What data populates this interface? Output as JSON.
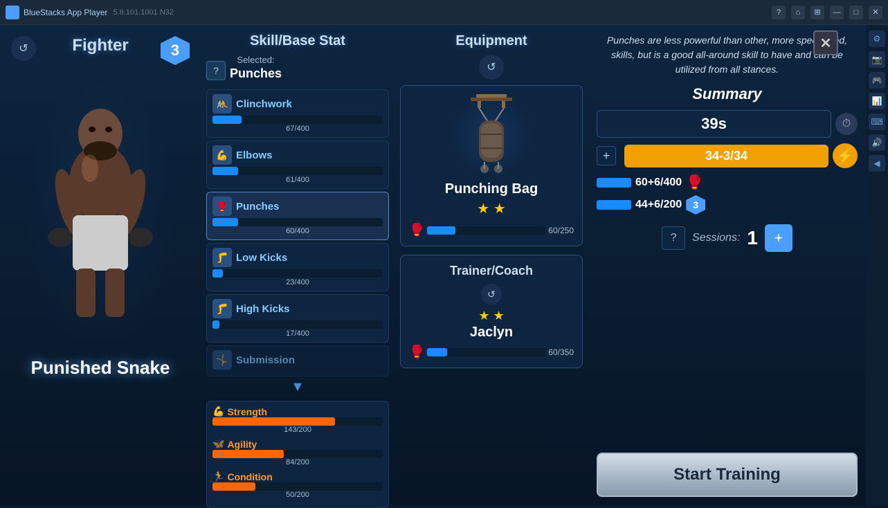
{
  "titlebar": {
    "appName": "BlueStacks App Player",
    "version": "5.8.101.1001  N32"
  },
  "fighter": {
    "title": "Fighter",
    "name": "Punished Snake",
    "level": "3",
    "refreshLabel": "↺"
  },
  "skillPanel": {
    "title": "Skill/Base Stat",
    "selectedLabel": "Selected:",
    "selectedSkill": "Punches",
    "helpLabel": "?",
    "skills": [
      {
        "name": "Clinchwork",
        "value": "67/400",
        "pct": 17,
        "color": "blue"
      },
      {
        "name": "Elbows",
        "value": "61/400",
        "pct": 15,
        "color": "blue"
      },
      {
        "name": "Punches",
        "value": "60/400",
        "pct": 15,
        "color": "blue",
        "selected": true
      },
      {
        "name": "Low Kicks",
        "value": "23/400",
        "pct": 6,
        "color": "blue"
      },
      {
        "name": "High Kicks",
        "value": "17/400",
        "pct": 4,
        "color": "blue"
      },
      {
        "name": "Submission",
        "value": "",
        "pct": 0,
        "color": "blue"
      }
    ],
    "stats": [
      {
        "name": "Strength",
        "value": "143/200",
        "pct": 72,
        "icon": "💪"
      },
      {
        "name": "Agility",
        "value": "84/200",
        "pct": 42,
        "icon": "🦋"
      },
      {
        "name": "Condition",
        "value": "50/200",
        "pct": 25,
        "icon": "🏃"
      }
    ]
  },
  "equipment": {
    "title": "Equipment",
    "refreshLabel": "↺",
    "item": {
      "name": "Punching Bag",
      "stars": "★ ★",
      "barValue": "60/250",
      "barPct": 24
    },
    "trainer": {
      "sectionTitle": "Trainer/Coach",
      "stars": "★ ★",
      "name": "Jaclyn",
      "barValue": "60/350",
      "barPct": 17
    }
  },
  "summary": {
    "title": "Summary",
    "infoText": "Punches are less powerful than other, more specialized, skills, but is a good all-around skill to have and can be utilized from all stances.",
    "time": "39s",
    "energy": "34-3/34",
    "stat1Value": "60+6/400",
    "stat2Value": "44+6/200",
    "stat2Badge": "3",
    "sessionsLabel": "Sessions:",
    "sessionsCount": "1",
    "startTraining": "Start Training"
  },
  "icons": {
    "close": "✕",
    "refresh": "↺",
    "clock": "⏱",
    "lightning": "⚡",
    "glove": "🥊",
    "plus": "+"
  }
}
